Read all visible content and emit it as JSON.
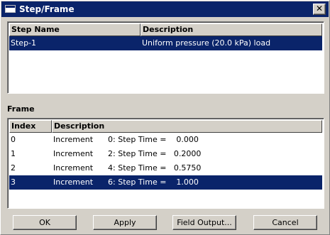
{
  "window": {
    "title": "Step/Frame",
    "close_glyph": "✕"
  },
  "step_list": {
    "columns": [
      "Step Name",
      "Description"
    ],
    "rows": [
      {
        "name": "Step-1",
        "description": "Uniform pressure (20.0 kPa) load",
        "selected": true
      }
    ]
  },
  "frame_section": {
    "label": "Frame"
  },
  "frame_list": {
    "columns": [
      "Index",
      "Description"
    ],
    "rows": [
      {
        "index": "0",
        "description": "Increment      0: Step Time =    0.000",
        "selected": false
      },
      {
        "index": "1",
        "description": "Increment      2: Step Time =   0.2000",
        "selected": false
      },
      {
        "index": "2",
        "description": "Increment      4: Step Time =   0.5750",
        "selected": false
      },
      {
        "index": "3",
        "description": "Increment      6: Step Time =    1.000",
        "selected": true
      }
    ]
  },
  "buttons": {
    "ok": "OK",
    "apply": "Apply",
    "field_output": "Field Output...",
    "cancel": "Cancel"
  }
}
